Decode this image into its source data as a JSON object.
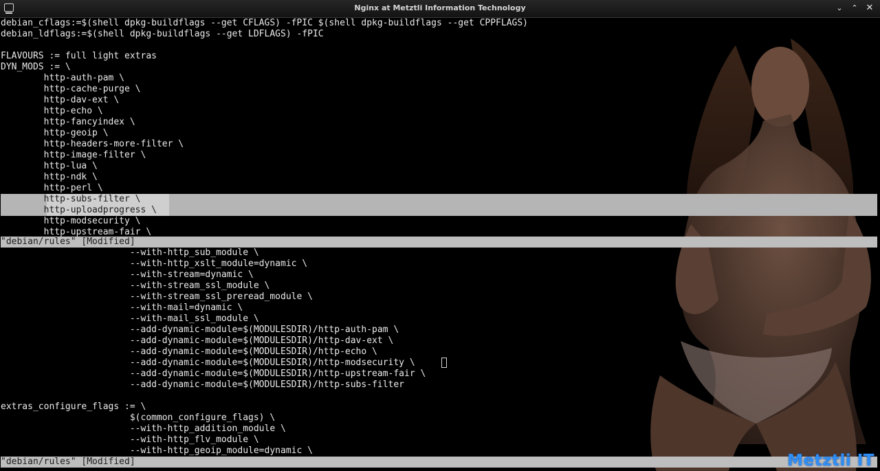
{
  "window": {
    "title": "Nginx at Metztli Information Technology",
    "minimize_glyph": "⌄",
    "maximize_glyph": "⌃",
    "close_glyph": "✕",
    "icon": "terminal-icon"
  },
  "pane_top": {
    "lines": [
      "debian_cflags:=$(shell dpkg-buildflags --get CFLAGS) -fPIC $(shell dpkg-buildflags --get CPPFLAGS)",
      "debian_ldflags:=$(shell dpkg-buildflags --get LDFLAGS) -fPIC",
      "",
      "FLAVOURS := full light extras",
      "DYN_MODS := \\",
      "        http-auth-pam \\",
      "        http-cache-purge \\",
      "        http-dav-ext \\",
      "        http-echo \\",
      "        http-fancyindex \\",
      "        http-geoip \\",
      "        http-headers-more-filter \\",
      "        http-image-filter \\",
      "        http-lua \\",
      "        http-ndk \\",
      "        http-perl \\",
      "        http-subs-filter \\",
      "        http-uploadprogress \\",
      "        http-modsecurity \\",
      "        http-upstream-fair \\"
    ],
    "status": "\"debian/rules\" [Modified]"
  },
  "pane_bottom": {
    "lines": [
      "                        --with-http_sub_module \\",
      "                        --with-http_xslt_module=dynamic \\",
      "                        --with-stream=dynamic \\",
      "                        --with-stream_ssl_module \\",
      "                        --with-stream_ssl_preread_module \\",
      "                        --with-mail=dynamic \\",
      "                        --with-mail_ssl_module \\",
      "                        --add-dynamic-module=$(MODULESDIR)/http-auth-pam \\",
      "                        --add-dynamic-module=$(MODULESDIR)/http-dav-ext \\",
      "                        --add-dynamic-module=$(MODULESDIR)/http-echo \\",
      "                        --add-dynamic-module=$(MODULESDIR)/http-modsecurity \\",
      "                        --add-dynamic-module=$(MODULESDIR)/http-upstream-fair \\",
      "                        --add-dynamic-module=$(MODULESDIR)/http-subs-filter",
      "",
      "extras_configure_flags := \\",
      "                        $(common_configure_flags) \\",
      "                        --with-http_addition_module \\",
      "                        --with-http_flv_module \\",
      "                        --with-http_geoip_module=dynamic \\"
    ],
    "status": "\"debian/rules\" [Modified]"
  },
  "watermark": "Metztli IT",
  "colors": {
    "text": "#ebebeb",
    "background": "#000000",
    "status_bar": "#bebebe",
    "selection": "#b5b5b5",
    "watermark": "#2f8ef5"
  }
}
